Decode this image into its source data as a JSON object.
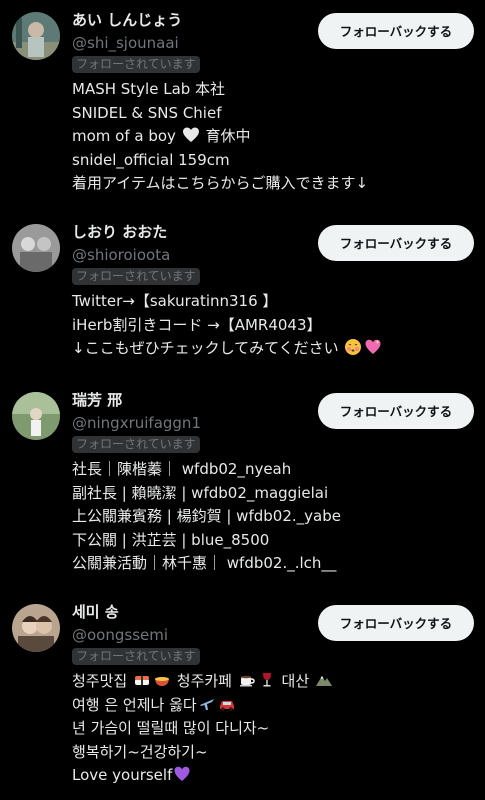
{
  "users": [
    {
      "name": "あい しんじょう",
      "handle": "@shi_sjounaai",
      "follows_you": "フォローされています",
      "button": "フォローバックする",
      "bio": [
        "MASH Style Lab 本社",
        "SNIDEL & SNS Chief",
        "mom of a boy",
        "育休中",
        "snidel_official 159cm",
        "着用アイテムはこちらからご購入できます↓"
      ]
    },
    {
      "name": "しおり おおた",
      "handle": "@shioroioota",
      "follows_you": "フォローされています",
      "button": "フォローバックする",
      "bio": [
        "Twitter→【sakuratinn316 】",
        "iHerb割引きコード →【AMR4043】",
        "↓ここもぜひチェックしてみてください"
      ]
    },
    {
      "name": "瑞芳 邢",
      "handle": "@ningxruifaggn1",
      "follows_you": "フォローされています",
      "button": "フォローバックする",
      "bio": [
        "社長｜陳楷蓁｜ wfdb02_nyeah",
        "副社長 | 賴曉潔 | wfdb02_maggielai",
        "上公關兼賓務 | 楊鈞賀 | wfdb02._yabe",
        "下公關 | 洪芷芸 | blue_8500",
        "公關兼活動｜林千惠｜ wfdb02._.lch__"
      ]
    },
    {
      "name": "세미 송",
      "handle": "@oongssemi",
      "follows_you": "フォローされています",
      "button": "フォローバックする",
      "bio": [
        "청주맛집",
        "청주카페",
        "대산",
        "여행 은 언제나 옳다",
        "년 가슴이 떨릴때 많이 다니자~",
        "행복하기~건강하기~",
        "Love yourself"
      ]
    }
  ],
  "colors": {
    "background": "#000000",
    "primary_text": "#e7e9ea",
    "secondary_text": "#71767b",
    "badge_bg": "#2f3336",
    "button_bg": "#eff3f4",
    "button_text": "#0f1419"
  }
}
